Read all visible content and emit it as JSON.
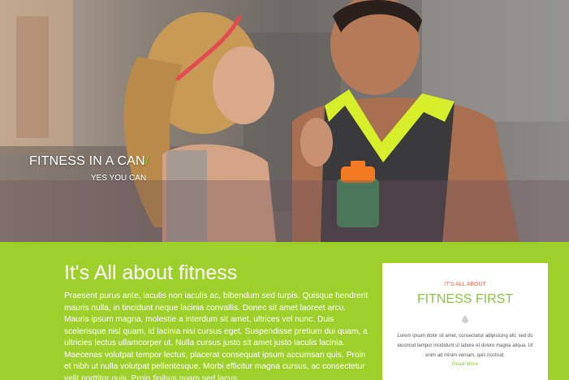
{
  "hero": {
    "tagline": "FITNESS IN A CAN",
    "tagline_slash": "/",
    "subtagline": "YES YOU CAN"
  },
  "about": {
    "heading": "It's All about fitness",
    "body": "Praesent purus ante, iaculis non iaculis ac, bibendum sed turpis. Quisque hendrerit mauris nulla, in tincidunt neque lacinia convallis. Donec sit amet laoreet arcu. Mauris ipsum magna, molestie a interdum sit amet, ultrices vel nunc. Duis scelerisque nisl quam, id lacinia nisi cursus eget. Suspendisse pretium dui quam, a ultricies lectus ullamcorper ut. Nulla cursus justo sit amet justo iaculis lacinia. Maecenas volutpat tempor lectus, placerat consequat ipsum accumsan quis. Proin et nibh ut nulla volutpat pellentesque. Morbi efficitur magna cursus, ac consectetur velit porttitor quis. Proin finibus quam sed lacus"
  },
  "card": {
    "eyebrow": "IT'S ALL ABOUT",
    "title": "FITNESS FIRST",
    "icon": "drop-icon",
    "text": "Lorem ipsum dolor sit amet, consectetur adipisicing elit, sed do eiusmod tempor incididunt ut labore et dolore magna aliqua. Ut enim ad minim veniam, quis nostrud.",
    "link": "Read More"
  },
  "colors": {
    "brand_green": "#9dd02b",
    "title_green": "#8bc53f",
    "eyebrow_orange": "#ec6b4c"
  }
}
